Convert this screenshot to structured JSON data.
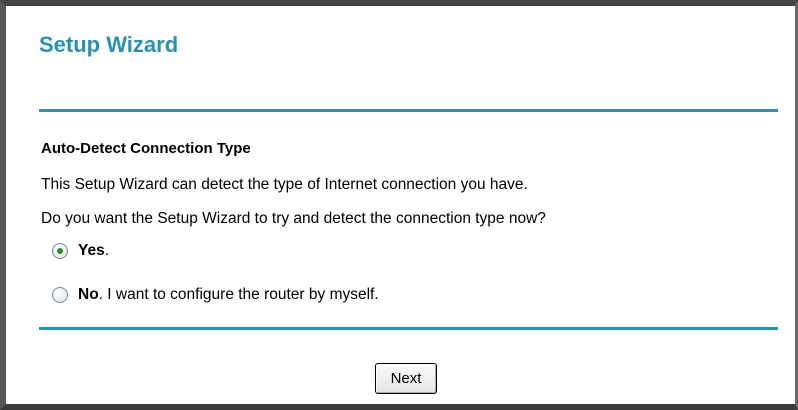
{
  "header": {
    "title": "Setup Wizard"
  },
  "section": {
    "heading": "Auto-Detect Connection Type",
    "line1": "This Setup Wizard can detect the type of Internet connection you have.",
    "line2": "Do you want the Setup Wizard to try and detect the connection type now?"
  },
  "options": {
    "yes": {
      "label": "Yes",
      "suffix": ".",
      "selected": true
    },
    "no": {
      "label": "No",
      "suffix": ". I want to configure the router by myself.",
      "selected": false
    }
  },
  "footer": {
    "next_label": "Next"
  },
  "colors": {
    "accent": "#2a8fb1",
    "radio_dot": "#2f8a2f"
  }
}
